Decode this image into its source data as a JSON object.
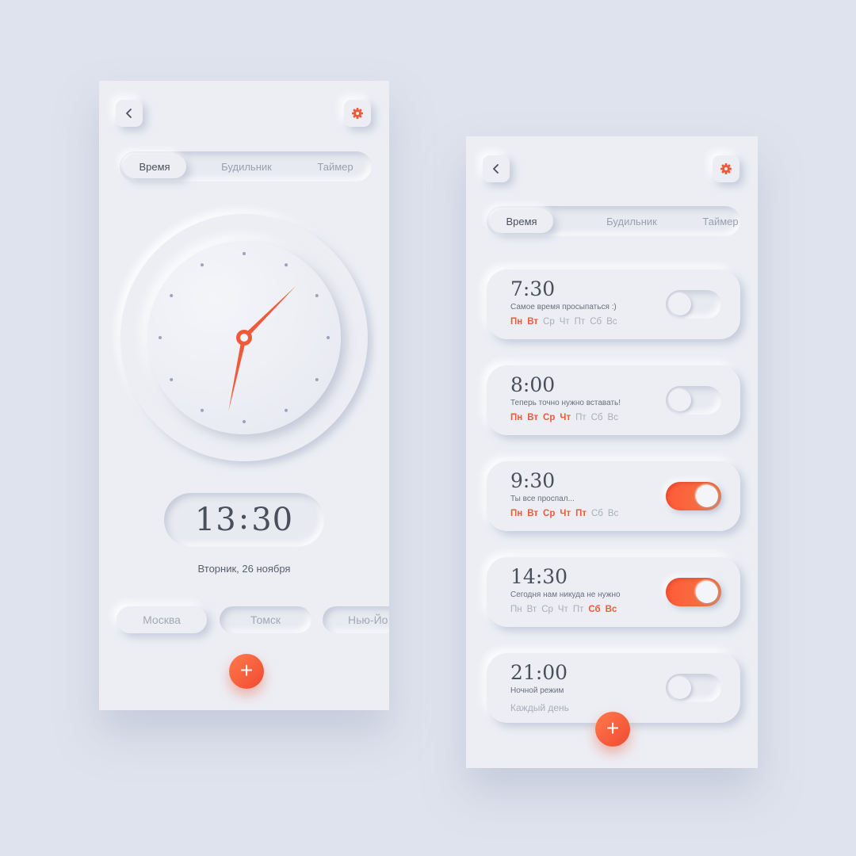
{
  "colors": {
    "accent": "#f0593a",
    "background": "#eceef4",
    "text": "#4a4f5c",
    "muted": "#a9aebb"
  },
  "screen1": {
    "tabs": [
      {
        "label": "Время",
        "active": true
      },
      {
        "label": "Будильник",
        "active": false
      },
      {
        "label": "Таймер",
        "active": false
      }
    ],
    "clock": {
      "hour": 13,
      "minute": 30
    },
    "time_display": {
      "hours": "13",
      "minutes": "30"
    },
    "date": "Вторник, 26 ноября",
    "cities": [
      {
        "label": "Москва",
        "active": true
      },
      {
        "label": "Томск",
        "active": false
      },
      {
        "label": "Нью-Йо",
        "active": false
      }
    ],
    "icons": {
      "back": "chevron-left-icon",
      "settings": "gear-icon",
      "add": "plus-icon"
    }
  },
  "screen2": {
    "tabs": [
      {
        "label": "Время",
        "active": true
      },
      {
        "label": "Будильник",
        "active": false
      },
      {
        "label": "Таймер",
        "active": false
      }
    ],
    "alarms": [
      {
        "hours": "7",
        "minutes": "30",
        "label": "Самое время просыпаться :)",
        "days": [
          {
            "d": "Пн",
            "on": true
          },
          {
            "d": "Вт",
            "on": true
          },
          {
            "d": "Ср",
            "on": false
          },
          {
            "d": "Чт",
            "on": false
          },
          {
            "d": "Пт",
            "on": false
          },
          {
            "d": "Сб",
            "on": false
          },
          {
            "d": "Вс",
            "on": false
          }
        ],
        "enabled": false
      },
      {
        "hours": "8",
        "minutes": "00",
        "label": "Теперь точно нужно вставать!",
        "days": [
          {
            "d": "Пн",
            "on": true
          },
          {
            "d": "Вт",
            "on": true
          },
          {
            "d": "Ср",
            "on": true
          },
          {
            "d": "Чт",
            "on": true
          },
          {
            "d": "Пт",
            "on": false
          },
          {
            "d": "Сб",
            "on": false
          },
          {
            "d": "Вс",
            "on": false
          }
        ],
        "enabled": false
      },
      {
        "hours": "9",
        "minutes": "30",
        "label": "Ты все проспал...",
        "days": [
          {
            "d": "Пн",
            "on": true
          },
          {
            "d": "Вт",
            "on": true
          },
          {
            "d": "Ср",
            "on": true
          },
          {
            "d": "Чт",
            "on": true
          },
          {
            "d": "Пт",
            "on": true
          },
          {
            "d": "Сб",
            "on": false
          },
          {
            "d": "Вс",
            "on": false
          }
        ],
        "enabled": true
      },
      {
        "hours": "14",
        "minutes": "30",
        "label": "Сегодня нам никуда не нужно",
        "days": [
          {
            "d": "Пн",
            "on": false
          },
          {
            "d": "Вт",
            "on": false
          },
          {
            "d": "Ср",
            "on": false
          },
          {
            "d": "Чт",
            "on": false
          },
          {
            "d": "Пт",
            "on": false
          },
          {
            "d": "Сб",
            "on": true
          },
          {
            "d": "Вс",
            "on": true
          }
        ],
        "enabled": true
      },
      {
        "hours": "21",
        "minutes": "00",
        "label": "Ночной режим",
        "repeat_text": "Каждый день",
        "enabled": false
      }
    ]
  }
}
